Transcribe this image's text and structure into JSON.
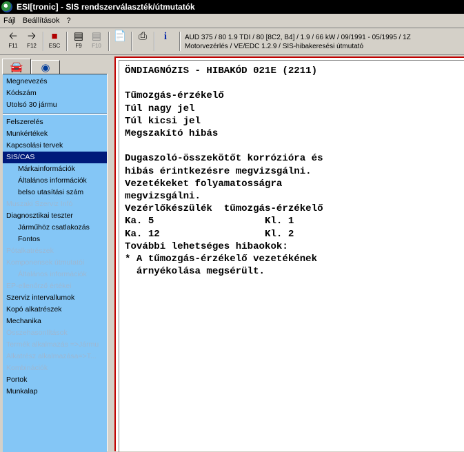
{
  "window": {
    "title": "ESI[tronic] - SIS rendszerválaszték/útmutatók"
  },
  "menu": [
    "Fájl",
    "Beállítások",
    "?"
  ],
  "toolbar": {
    "buttons": [
      {
        "key": "F11",
        "icon": "arrow-left-icon"
      },
      {
        "key": "F12",
        "icon": "arrow-right-icon"
      },
      {
        "key": "ESC",
        "icon": "escape-icon"
      },
      {
        "key": "F9",
        "icon": "document-list-icon"
      },
      {
        "key": "F10",
        "icon": "document-list-disabled-icon"
      },
      {
        "key": "",
        "icon": "page-icon"
      },
      {
        "key": "",
        "icon": "printer-icon"
      },
      {
        "key": "",
        "icon": "info-icon"
      }
    ],
    "vehicle_line1": "AUD 375 / 80 1.9 TDI / 80 [8C2, B4] / 1.9 / 66 kW / 09/1991 - 05/1995 / 1Z",
    "vehicle_line2": "Motorvezérlés / VE/EDC 1.2.9 / SIS-hibakeresési útmutató"
  },
  "tabs": [
    {
      "icon": "car-icon",
      "active": true
    },
    {
      "icon": "motorbike-icon",
      "active": false
    }
  ],
  "sidebar": {
    "items": [
      "Megnevezés",
      "Kódszám",
      "Utolsó 30 jármu",
      "Felszerelés",
      "Munkértékek",
      "Kapcsolási tervek",
      "SIS/CAS",
      "Márkainformációk",
      "Általános információk",
      "belso utasítási szám",
      "Muszaki Szerviz Infó",
      "Diagnosztikai teszter",
      "Járműhöz csatlakozás",
      "Fontos",
      "Pótalkatrészek",
      "Komponensek útmutatói",
      "Általános információk",
      "EP-ellenőrző értékei",
      "Szerviz intervallumok",
      "Kopó alkatrészek",
      "Mechanika",
      "Összehasonlítások",
      "Termék alkalmazás =>Jármu",
      "Alkatrész alkalmazása=>T...",
      "Kombinációk",
      "Portok",
      "Munkalap"
    ]
  },
  "content": {
    "heading": "ÖNDIAGNÓZIS - HIBAKÓD 021E (2211)",
    "lines": [
      "Tűmozgás-érzékelő",
      "Túl nagy jel",
      "Túl kicsi jel",
      "Megszakító hibás",
      "Dugaszoló-összekötőt korrózióra és",
      "hibás érintkezésre megvizsgálni.",
      "Vezetékeket folyamatosságra",
      "megvizsgálni.",
      "Vezérlőkészülék  tűmozgás-érzékelő",
      "Ka. 5                   Kl. 1",
      "Ka. 12                  Kl. 2",
      "További lehetséges hibaokok:",
      "* A tűmozgás-érzékelő vezetékének",
      "  árnyékolása megsérült."
    ]
  }
}
